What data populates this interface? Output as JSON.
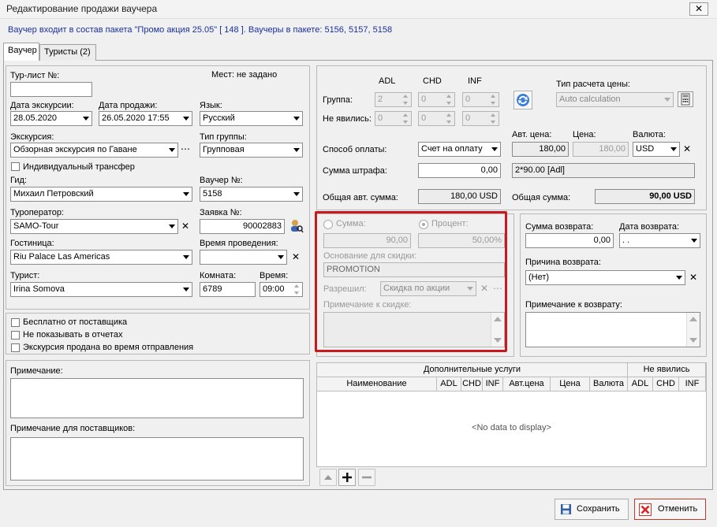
{
  "window": {
    "title": "Редактирование продажи ваучера",
    "close": "✕"
  },
  "info": "Ваучер входит в состав пакета \"Промо акция 25.05\" [ 148 ]. Ваучеры в пакете:  5156, 5157, 5158",
  "tabs": [
    "Ваучер",
    "Туристы (2)"
  ],
  "left": {
    "tourlist_label": "Тур-лист №:",
    "tourlist_value": "",
    "seats_text": "Мест: не задано",
    "excursion_date_label": "Дата экскурсии:",
    "excursion_date": "28.05.2020",
    "sale_date_label": "Дата продажи:",
    "sale_date": "26.05.2020 17:55",
    "language_label": "Язык:",
    "language": "Русский",
    "excursion_label": "Экскурсия:",
    "excursion": "Обзорная экскурсия по Гаване",
    "group_type_label": "Тип группы:",
    "group_type": "Групповая",
    "individual_transfer": "Индивидуальный трансфер",
    "guide_label": "Гид:",
    "guide": "Михаил Петровский",
    "voucher_no_label": "Ваучер №:",
    "voucher_no": "5158",
    "operator_label": "Туроператор:",
    "operator": "SAMO-Tour",
    "request_label": "Заявка №:",
    "request": "90002883",
    "hotel_label": "Гостиница:",
    "hotel": "Riu Palace Las Americas",
    "time_label": "Время проведения:",
    "time_value": "",
    "tourist_label": "Турист:",
    "tourist": "Irina Somova",
    "room_label": "Комната:",
    "room": "6789",
    "hour_label": "Время:",
    "hour": "09:00",
    "free_supplier": "Бесплатно от поставщика",
    "hide_reports": "Не показывать в отчетах",
    "sold_departure": "Экскурсия продана во время отправления",
    "note_label": "Примечание:",
    "supplier_note_label": "Примечание для поставщиков:"
  },
  "price": {
    "adl": "ADL",
    "chd": "CHD",
    "inf": "INF",
    "group_label": "Группа:",
    "group_adl": "2",
    "group_chd": "0",
    "group_inf": "0",
    "noshow_label": "Не явились:",
    "noshow_adl": "0",
    "noshow_chd": "0",
    "noshow_inf": "0",
    "calc_type_label": "Тип расчета цены:",
    "calc_type": "Auto calculation",
    "auto_price_label": "Авт. цена:",
    "auto_price": "180,00",
    "price_label": "Цена:",
    "price": "180,00",
    "currency_label": "Валюта:",
    "currency": "USD",
    "payment_label": "Способ оплаты:",
    "payment": "Счет на оплату",
    "penalty_label": "Сумма штрафа:",
    "penalty": "0,00",
    "formula": "2*90.00 [Adl]",
    "total_auto_label": "Общая авт. сумма:",
    "total_auto": "180,00  USD",
    "total_label": "Общая сумма:",
    "total": "90,00  USD"
  },
  "discount": {
    "sum_label": "Сумма:",
    "sum": "90,00",
    "percent_label": "Процент:",
    "percent": "50,00%",
    "reason_label": "Основание для скидки:",
    "reason": "PROMOTION",
    "allowed_label": "Разрешил:",
    "allowed": "Скидка по акции",
    "note_label": "Примечание к скидке:"
  },
  "refund": {
    "sum_label": "Сумма возврата:",
    "sum": "0,00",
    "date_label": "Дата возврата:",
    "date": ". .",
    "reason_label": "Причина возврата:",
    "reason": "(Нет)",
    "note_label": "Примечание к возврату:"
  },
  "services": {
    "header": "Дополнительные услуги",
    "noshow_header": "Не явились",
    "columns": [
      "Наименование",
      "ADL",
      "CHD",
      "INF",
      "Авт.цена",
      "Цена",
      "Валюта",
      "ADL",
      "CHD",
      "INF"
    ],
    "empty": "<No data to display>"
  },
  "buttons": {
    "save": "Сохранить",
    "cancel": "Отменить"
  },
  "colors": {
    "highlight": "#c8191c",
    "info_text": "#1a2fa0"
  }
}
